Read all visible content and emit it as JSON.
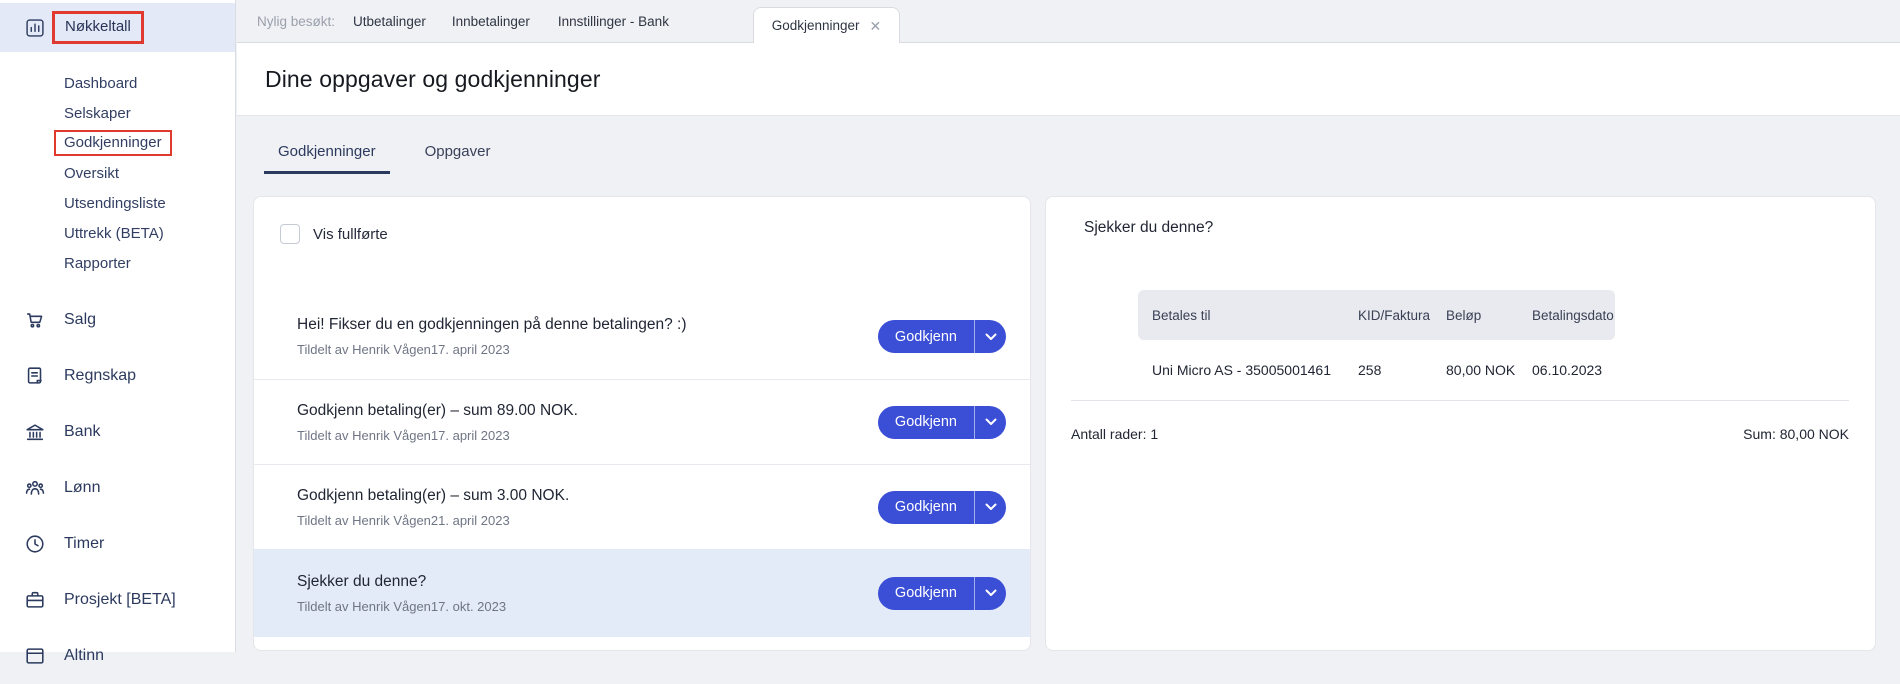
{
  "sidebar": {
    "header": {
      "label": "Nøkkeltall"
    },
    "sub_items": [
      {
        "label": "Dashboard",
        "highlighted": false
      },
      {
        "label": "Selskaper",
        "highlighted": false
      },
      {
        "label": "Godkjenninger",
        "highlighted": true
      },
      {
        "label": "Oversikt",
        "highlighted": false
      },
      {
        "label": "Utsendingsliste",
        "highlighted": false
      },
      {
        "label": "Uttrekk (BETA)",
        "highlighted": false
      },
      {
        "label": "Rapporter",
        "highlighted": false
      }
    ],
    "main_items": [
      {
        "label": "Salg",
        "icon": "cart-icon"
      },
      {
        "label": "Regnskap",
        "icon": "ledger-icon"
      },
      {
        "label": "Bank",
        "icon": "bank-icon"
      },
      {
        "label": "Lønn",
        "icon": "people-icon"
      },
      {
        "label": "Timer",
        "icon": "clock-icon"
      },
      {
        "label": "Prosjekt [BETA]",
        "icon": "briefcase-icon"
      },
      {
        "label": "Altinn",
        "icon": "window-icon"
      }
    ]
  },
  "recent_bar": {
    "label": "Nylig besøkt:",
    "tabs": [
      "Utbetalinger",
      "Innbetalinger",
      "Innstillinger - Bank"
    ],
    "active_tab": {
      "label": "Godkjenninger",
      "close_glyph": "✕"
    }
  },
  "page": {
    "title": "Dine oppgaver og godkjenninger"
  },
  "tabs": {
    "approvals_label": "Godkjenninger",
    "tasks_label": "Oppgaver"
  },
  "approvals": {
    "show_completed_label": "Vis fullførte",
    "approve_label": "Godkjenn",
    "items": [
      {
        "title": "Hei! Fikser du en godkjenningen på denne betalingen? :)",
        "subtitle": "Tildelt av Henrik Vågen17. april 2023",
        "selected": false
      },
      {
        "title": "Godkjenn betaling(er) – sum 89.00 NOK.",
        "subtitle": "Tildelt av Henrik Vågen17. april 2023",
        "selected": false
      },
      {
        "title": "Godkjenn betaling(er) – sum 3.00 NOK.",
        "subtitle": "Tildelt av Henrik Vågen21. april 2023",
        "selected": false
      },
      {
        "title": "Sjekker du denne?",
        "subtitle": "Tildelt av Henrik Vågen17. okt. 2023",
        "selected": true
      }
    ]
  },
  "detail": {
    "title": "Sjekker du denne?",
    "table": {
      "headers": [
        "Betales til",
        "KID/Faktura",
        "Beløp",
        "Betalingsdato"
      ],
      "rows": [
        [
          "Uni Micro AS - 35005001461",
          "258",
          "80,00 NOK",
          "06.10.2023"
        ]
      ]
    },
    "row_count_label": "Antall rader: 1",
    "sum_label": "Sum: 80,00 NOK"
  },
  "colors": {
    "accent_blue": "#3b4ed6",
    "frame_red": "#df3a2d",
    "selected_row_bg": "#e3eaf8",
    "navy": "#2b3a5e",
    "band_lavender": "#e4e9f7"
  }
}
